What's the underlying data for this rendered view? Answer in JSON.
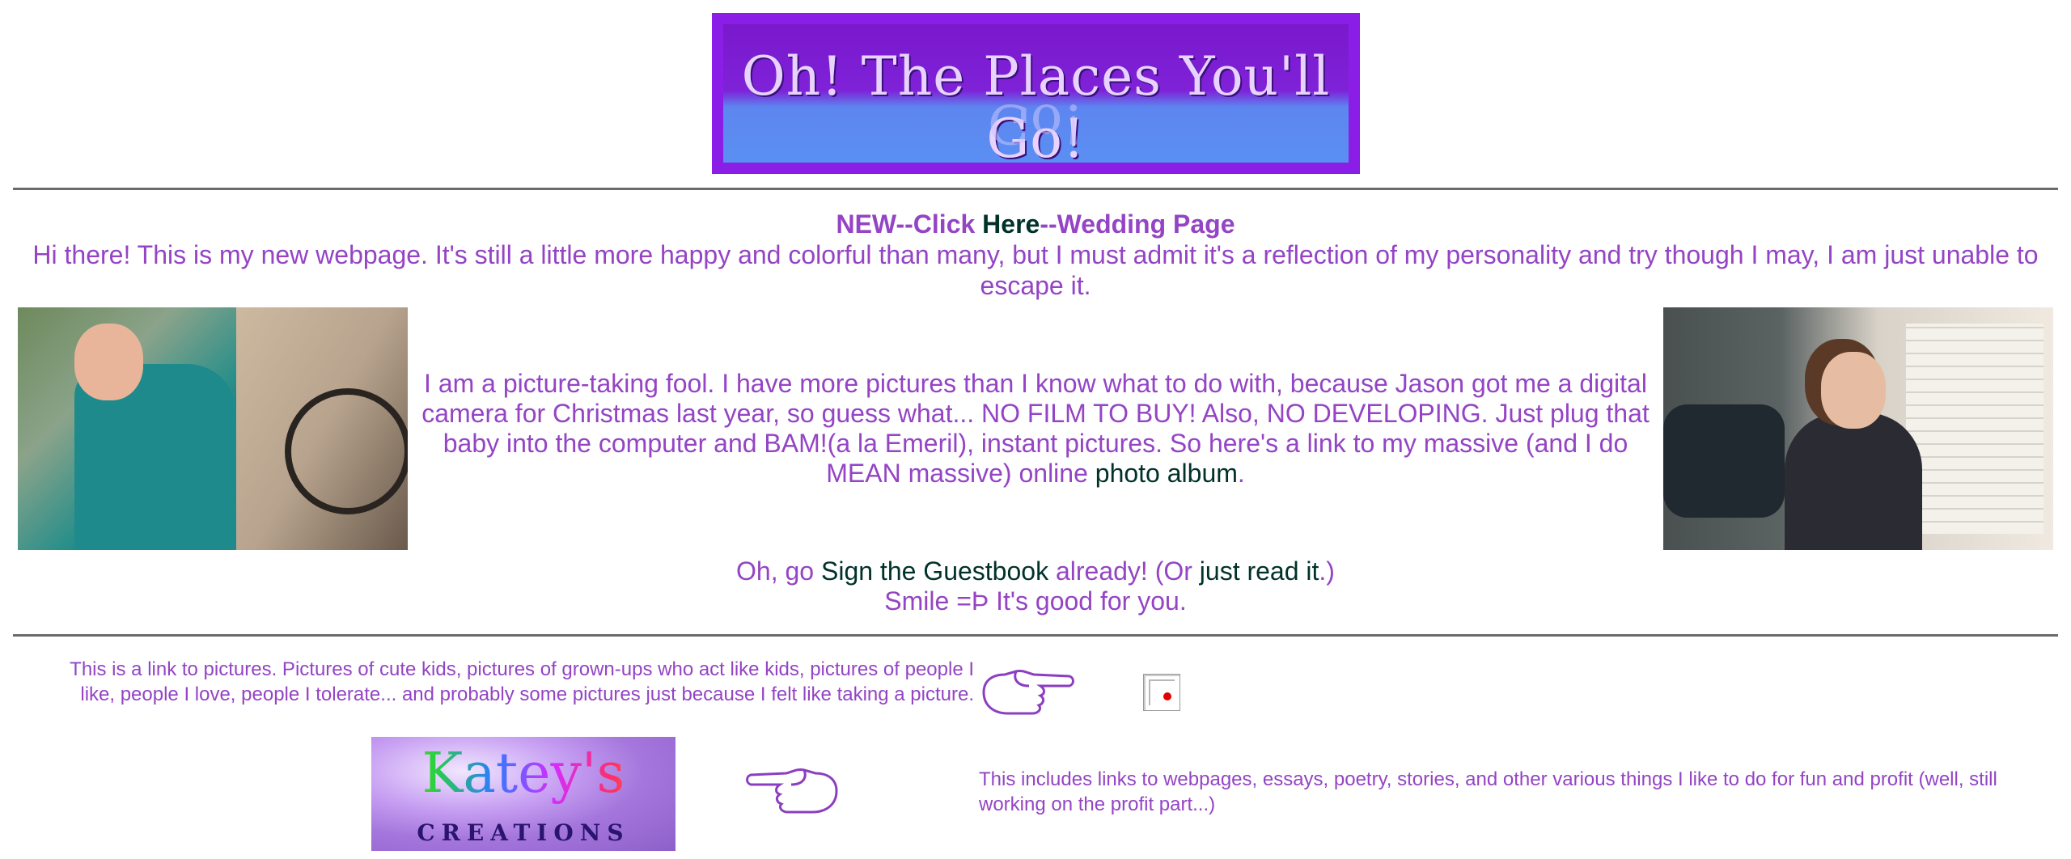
{
  "banner": {
    "title": "Oh! The Places You'll Go!"
  },
  "news": {
    "prefix": "NEW--Click ",
    "link": "Here",
    "suffix": "--Wedding Page"
  },
  "intro": "Hi there! This is my new webpage. It's still a little more happy and colorful than many, but I must admit it's a reflection of my personality and try though I may, I am just unable to escape it.",
  "pictures": {
    "text": "I am a picture-taking fool. I have more pictures than I know what to do with, because Jason got me a digital camera for Christmas last year, so guess what... NO FILM TO BUY! Also, NO DEVELOPING. Just plug that baby into the computer and BAM!(a la Emeril), instant pictures. So here's a link to my massive (and I do MEAN massive) online ",
    "link": "photo album",
    "end": "."
  },
  "guestbook": {
    "p1": "Oh, go ",
    "sign_link": "Sign the Guestbook",
    "p2": " already! (Or ",
    "read_link": "just read it",
    "p3": ".)",
    "line2": "Smile =Þ It's good for you."
  },
  "bottom": {
    "pictures_desc": "This is a link to pictures. Pictures of cute kids, pictures of grown-ups who act like kids, pictures of people I like, people I love, people I tolerate... and probably some pictures just because I felt like taking a picture.",
    "creations_logo_top": "Katey's",
    "creations_logo_bottom": "CREATIONS",
    "creations_desc": "This includes links to webpages, essays, poetry, stories, and other various things I like to do for fun and profit (well, still working on the profit part...)"
  },
  "colors": {
    "text": "#9444c4",
    "link": "#00322a",
    "rule": "#6b6b6b"
  }
}
